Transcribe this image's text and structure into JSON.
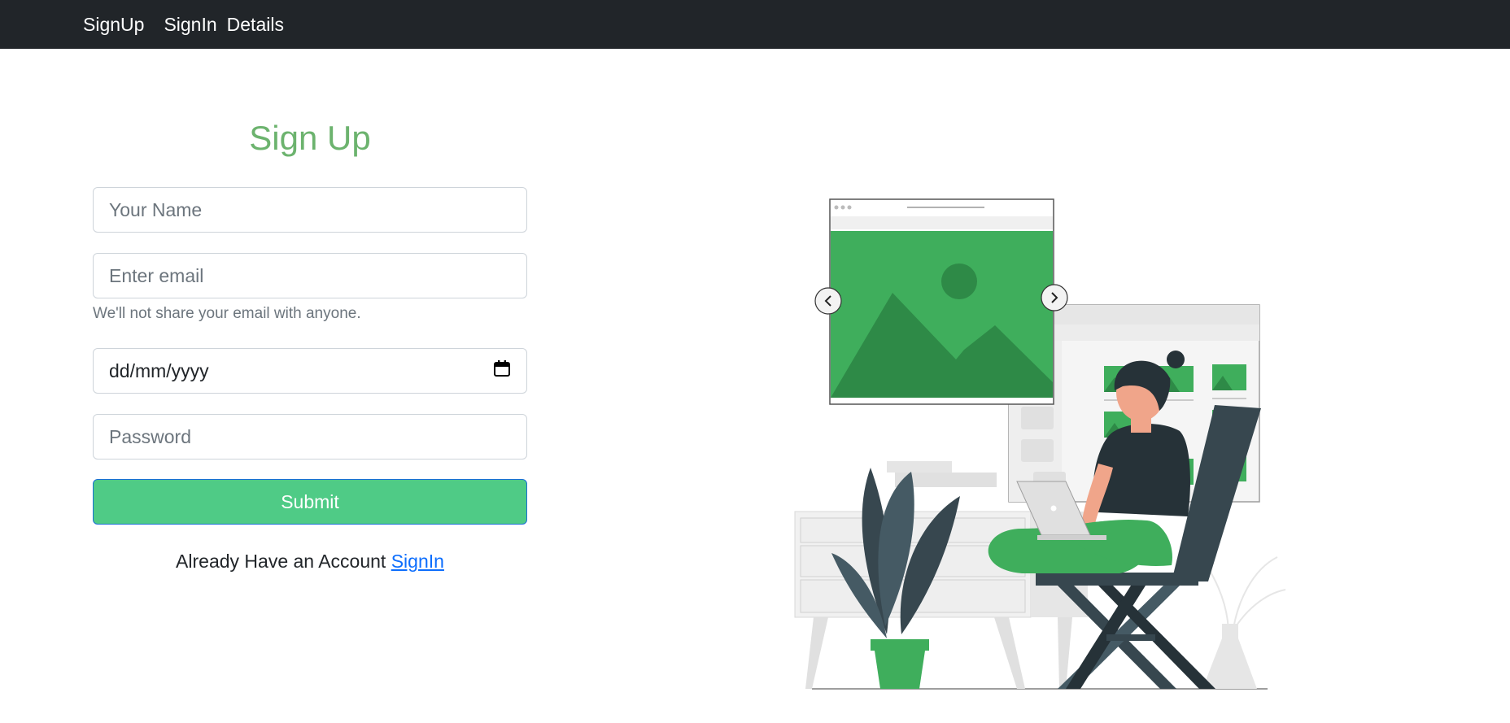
{
  "nav": {
    "items": [
      "SignUp",
      "SignIn",
      "Details"
    ]
  },
  "form": {
    "title": "Sign Up",
    "name_placeholder": "Your Name",
    "email_placeholder": "Enter email",
    "email_help": "We'll not share your email with anyone.",
    "date_value": "dd/mm/yyyy",
    "password_placeholder": "Password",
    "submit_label": "Submit",
    "already_text": "Already Have an Account",
    "signin_link": "SignIn"
  },
  "colors": {
    "navbar_bg": "#212529",
    "title_green": "#6cb36e",
    "submit_green": "#4fcb86",
    "illustration_green": "#3fae5c"
  },
  "icons": {
    "date": "calendar-icon",
    "carousel_prev": "chevron-left-icon",
    "carousel_next": "chevron-right-icon"
  }
}
